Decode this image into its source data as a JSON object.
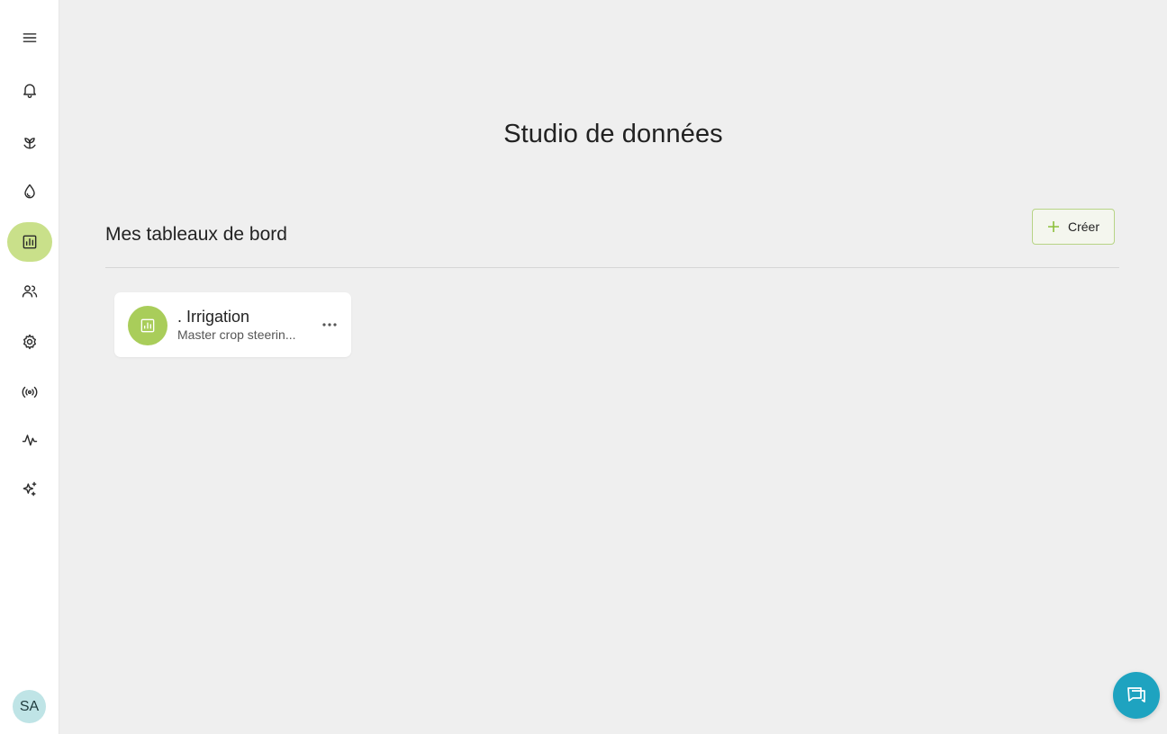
{
  "sidebar": {
    "items": [
      {
        "name": "menu",
        "icon": "hamburger-menu-icon"
      },
      {
        "name": "notifications",
        "icon": "bell-icon"
      },
      {
        "name": "crops",
        "icon": "sprout-icon"
      },
      {
        "name": "irrigation",
        "icon": "water-drop-icon"
      },
      {
        "name": "data-studio",
        "icon": "bar-chart-icon",
        "active": true
      },
      {
        "name": "users",
        "icon": "users-icon"
      },
      {
        "name": "settings",
        "icon": "gear-icon"
      },
      {
        "name": "sensors",
        "icon": "broadcast-icon"
      },
      {
        "name": "analytics",
        "icon": "activity-icon"
      },
      {
        "name": "ai",
        "icon": "sparkles-icon"
      }
    ],
    "avatar_initials": "SA"
  },
  "page": {
    "title": "Studio de données"
  },
  "dashboards": {
    "section_title": "Mes tableaux de bord",
    "create_label": "Créer",
    "items": [
      {
        "title": ". Irrigation",
        "subtitle": "Master crop steerin...",
        "icon": "bar-chart-icon"
      }
    ]
  },
  "chat": {
    "icon": "chat-icon"
  },
  "colors": {
    "accent_green": "#a9cd5a",
    "active_nav": "#c9e08a",
    "chat_blue": "#1ea3c0",
    "avatar_bg": "#bfe4e6"
  }
}
